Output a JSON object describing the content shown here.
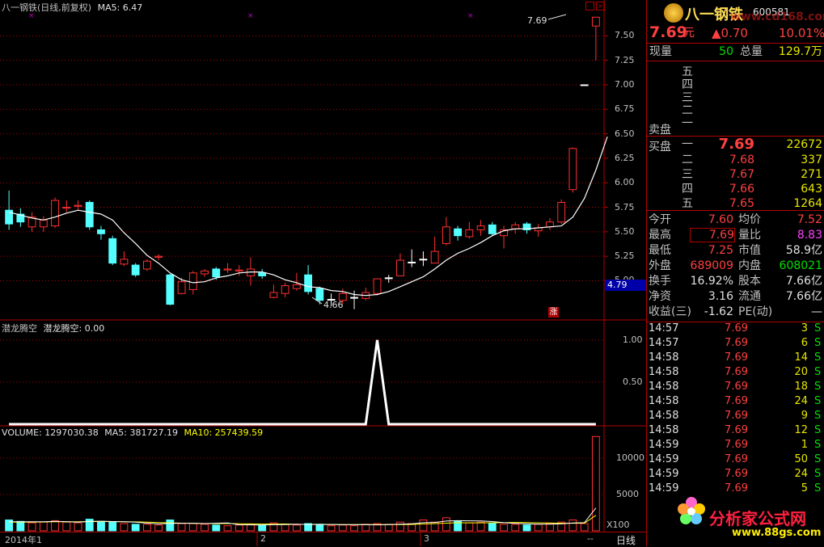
{
  "header": {
    "title": "八一钢铁(日线,前复权)",
    "ma_label": "MA5: 6.47",
    "indicator_label": "潜龙腾空",
    "indicator_value": "潜龙腾空: 0.00",
    "volume_label": "VOLUME: 1297030.38",
    "volume_ma5": "MA5: 381727.19",
    "volume_ma10": "MA10: 257439.59"
  },
  "price_axis": {
    "ticks": [
      "7.50",
      "7.25",
      "7.00",
      "6.75",
      "6.50",
      "6.25",
      "6.00",
      "5.75",
      "5.50",
      "5.25",
      "5.00"
    ],
    "cursor_value": "4.79"
  },
  "indicator_axis": {
    "ticks": [
      "1.00",
      "0.50"
    ]
  },
  "volume_axis": {
    "ticks": [
      "10000",
      "5000"
    ],
    "unit": "X100"
  },
  "annotations": {
    "high_marker": "7.69",
    "low_marker": "4.66",
    "zhang_badge": "涨"
  },
  "time_axis": {
    "labels": [
      "2014年1",
      "2",
      "3"
    ],
    "period": "日线",
    "nav": "--"
  },
  "colors": {
    "up": "#ff3030",
    "down": "#54ffff",
    "ma": "#ffffff",
    "grid": "#b00000",
    "ma5": "#ffffff",
    "ma10": "#ffff00"
  },
  "chart_data": {
    "type": "candlestick",
    "candles": [
      {
        "o": 5.72,
        "c": 5.58,
        "h": 5.92,
        "l": 5.52
      },
      {
        "o": 5.68,
        "c": 5.6,
        "h": 5.74,
        "l": 5.55
      },
      {
        "o": 5.55,
        "c": 5.65,
        "h": 5.7,
        "l": 5.5
      },
      {
        "o": 5.55,
        "c": 5.62,
        "h": 5.66,
        "l": 5.5
      },
      {
        "o": 5.56,
        "c": 5.82,
        "h": 5.85,
        "l": 5.54
      },
      {
        "o": 5.74,
        "c": 5.75,
        "h": 5.82,
        "l": 5.7
      },
      {
        "o": 5.76,
        "c": 5.77,
        "h": 5.82,
        "l": 5.72
      },
      {
        "o": 5.8,
        "c": 5.55,
        "h": 5.82,
        "l": 5.52
      },
      {
        "o": 5.52,
        "c": 5.48,
        "h": 5.56,
        "l": 5.42
      },
      {
        "o": 5.43,
        "c": 5.18,
        "h": 5.46,
        "l": 5.16
      },
      {
        "o": 5.17,
        "c": 5.22,
        "h": 5.3,
        "l": 5.15
      },
      {
        "o": 5.16,
        "c": 5.06,
        "h": 5.18,
        "l": 5.04
      },
      {
        "o": 5.12,
        "c": 5.2,
        "h": 5.22,
        "l": 5.1
      },
      {
        "o": 5.24,
        "c": 5.25,
        "h": 5.27,
        "l": 5.21
      },
      {
        "o": 5.06,
        "c": 4.76,
        "h": 5.07,
        "l": 4.75
      },
      {
        "o": 4.87,
        "c": 4.99,
        "h": 5.03,
        "l": 4.86
      },
      {
        "o": 4.91,
        "c": 5.08,
        "h": 5.1,
        "l": 4.86
      },
      {
        "o": 5.07,
        "c": 5.1,
        "h": 5.12,
        "l": 5.04
      },
      {
        "o": 5.12,
        "c": 5.04,
        "h": 5.14,
        "l": 5.01
      },
      {
        "o": 5.11,
        "c": 5.12,
        "h": 5.18,
        "l": 5.08
      },
      {
        "o": 5.1,
        "c": 5.11,
        "h": 5.16,
        "l": 5.05
      },
      {
        "o": 5.05,
        "c": 5.12,
        "h": 5.24,
        "l": 4.95
      },
      {
        "o": 5.08,
        "c": 5.05,
        "h": 5.12,
        "l": 5.02
      },
      {
        "o": 4.83,
        "c": 4.88,
        "h": 4.96,
        "l": 4.82
      },
      {
        "o": 4.87,
        "c": 4.95,
        "h": 4.98,
        "l": 4.83
      },
      {
        "o": 4.92,
        "c": 4.96,
        "h": 5.08,
        "l": 4.9
      },
      {
        "o": 5.06,
        "c": 4.89,
        "h": 5.16,
        "l": 4.86
      },
      {
        "o": 4.92,
        "c": 4.8,
        "h": 4.94,
        "l": 4.76
      },
      {
        "o": 4.81,
        "c": 4.81,
        "h": 4.87,
        "l": 4.74
      },
      {
        "o": 4.8,
        "c": 4.87,
        "h": 4.92,
        "l": 4.76
      },
      {
        "o": 4.83,
        "c": 4.83,
        "h": 4.9,
        "l": 4.71
      },
      {
        "o": 4.82,
        "c": 4.88,
        "h": 4.93,
        "l": 4.8
      },
      {
        "o": 4.87,
        "c": 5.02,
        "h": 5.02,
        "l": 4.85
      },
      {
        "o": 5.03,
        "c": 5.03,
        "h": 5.06,
        "l": 4.98
      },
      {
        "o": 5.05,
        "c": 5.21,
        "h": 5.28,
        "l": 5.05
      },
      {
        "o": 5.19,
        "c": 5.19,
        "h": 5.32,
        "l": 5.14
      },
      {
        "o": 5.22,
        "c": 5.22,
        "h": 5.3,
        "l": 5.15
      },
      {
        "o": 5.18,
        "c": 5.3,
        "h": 5.45,
        "l": 5.18
      },
      {
        "o": 5.38,
        "c": 5.55,
        "h": 5.65,
        "l": 5.36
      },
      {
        "o": 5.53,
        "c": 5.46,
        "h": 5.56,
        "l": 5.41
      },
      {
        "o": 5.45,
        "c": 5.52,
        "h": 5.6,
        "l": 5.43
      },
      {
        "o": 5.52,
        "c": 5.56,
        "h": 5.62,
        "l": 5.46
      },
      {
        "o": 5.57,
        "c": 5.48,
        "h": 5.6,
        "l": 5.46
      },
      {
        "o": 5.46,
        "c": 5.52,
        "h": 5.56,
        "l": 5.33
      },
      {
        "o": 5.53,
        "c": 5.57,
        "h": 5.6,
        "l": 5.48
      },
      {
        "o": 5.58,
        "c": 5.52,
        "h": 5.6,
        "l": 5.48
      },
      {
        "o": 5.51,
        "c": 5.54,
        "h": 5.58,
        "l": 5.45
      },
      {
        "o": 5.55,
        "c": 5.6,
        "h": 5.64,
        "l": 5.52
      },
      {
        "o": 5.6,
        "c": 5.8,
        "h": 5.83,
        "l": 5.58
      },
      {
        "o": 5.93,
        "c": 6.35,
        "h": 6.36,
        "l": 5.9
      },
      {
        "o": 7.0,
        "c": 7.0,
        "h": 7.0,
        "l": 7.0
      },
      {
        "o": 7.6,
        "c": 7.69,
        "h": 7.69,
        "l": 7.25
      }
    ],
    "ma5": [
      5.7,
      5.67,
      5.64,
      5.62,
      5.65,
      5.69,
      5.72,
      5.7,
      5.68,
      5.62,
      5.49,
      5.38,
      5.26,
      5.18,
      5.08,
      5.01,
      4.98,
      4.99,
      5.03,
      5.05,
      5.08,
      5.09,
      5.09,
      5.06,
      5.01,
      4.98,
      4.94,
      4.93,
      4.9,
      4.89,
      4.86,
      4.85,
      4.86,
      4.89,
      4.94,
      4.99,
      5.04,
      5.12,
      5.21,
      5.28,
      5.33,
      5.39,
      5.46,
      5.51,
      5.53,
      5.53,
      5.54,
      5.55,
      5.56,
      5.65,
      5.84,
      6.13,
      6.47
    ],
    "indicator": [
      0,
      0,
      0,
      0,
      0,
      0,
      0,
      0,
      0,
      0,
      0,
      0,
      0,
      0,
      0,
      0,
      0,
      0,
      0,
      0,
      0,
      0,
      0,
      0,
      0,
      0,
      0,
      0,
      0,
      0,
      0,
      0,
      1,
      0,
      0,
      0,
      0,
      0,
      0,
      0,
      0,
      0,
      0,
      0,
      0,
      0,
      0,
      0,
      0,
      0,
      0,
      0
    ],
    "volume": [
      1500,
      1300,
      1100,
      1200,
      1400,
      1200,
      1100,
      1600,
      1300,
      1200,
      1000,
      900,
      900,
      800,
      1500,
      1000,
      1000,
      900,
      800,
      700,
      800,
      900,
      800,
      1100,
      900,
      800,
      1000,
      900,
      700,
      800,
      700,
      900,
      1000,
      900,
      1200,
      1000,
      1500,
      1200,
      1800,
      1300,
      1100,
      1200,
      1000,
      900,
      900,
      800,
      900,
      1000,
      1200,
      1500,
      1000,
      12970
    ],
    "volume_ma5": [
      1250,
      1250,
      1250,
      1250,
      1300,
      1240,
      1200,
      1300,
      1320,
      1280,
      1240,
      1200,
      1060,
      960,
      1020,
      1040,
      1040,
      1000,
      1050,
      1080,
      840,
      820,
      800,
      840,
      860,
      900,
      880,
      900,
      880,
      840,
      840,
      860,
      820,
      860,
      920,
      960,
      1120,
      1160,
      1340,
      1400,
      1380,
      1360,
      1280,
      1120,
      1020,
      960,
      920,
      920,
      960,
      1080,
      1120,
      3140
    ],
    "volume_ma10": [
      1200,
      1200,
      1200,
      1220,
      1250,
      1250,
      1260,
      1270,
      1280,
      1270,
      1250,
      1230,
      1200,
      1140,
      1100,
      1060,
      1040,
      1000,
      1000,
      1010,
      980,
      960,
      930,
      930,
      940,
      900,
      880,
      880,
      860,
      860,
      860,
      870,
      860,
      860,
      870,
      880,
      950,
      1000,
      1060,
      1120,
      1100,
      1100,
      1110,
      1120,
      1150,
      1130,
      1100,
      1080,
      1040,
      1040,
      1050,
      2130
    ],
    "price_ylim": [
      4.6,
      7.75
    ],
    "volume_ylim": [
      0,
      14000
    ],
    "indicator_ylim": [
      0,
      1.2
    ]
  },
  "panel": {
    "logo_name": "八一钢铁",
    "logo_code": "600581",
    "watermark_top": "www.cd168.com",
    "price": "7.69",
    "unit": "元",
    "change": "▲0.70",
    "pct": "10.01%",
    "xianliang_label": "现量",
    "xianliang": "50",
    "zongliang_label": "总量",
    "zongliang": "129.7万",
    "sell_levels": [
      "五",
      "四",
      "三",
      "二",
      "一"
    ],
    "sell_label": "卖盘",
    "buy_label": "买盘",
    "buys": [
      {
        "lvl": "一",
        "price": "7.69",
        "vol": "22672"
      },
      {
        "lvl": "二",
        "price": "7.68",
        "vol": "337"
      },
      {
        "lvl": "三",
        "price": "7.67",
        "vol": "271"
      },
      {
        "lvl": "四",
        "price": "7.66",
        "vol": "643"
      },
      {
        "lvl": "五",
        "price": "7.65",
        "vol": "1264"
      }
    ],
    "stats": [
      {
        "l1": "今开",
        "v1": "7.60",
        "c1": "red",
        "l2": "均价",
        "v2": "7.52",
        "c2": "red"
      },
      {
        "l1": "最高",
        "v1": "7.69",
        "c1": "red",
        "l2": "量比",
        "v2": "8.83",
        "c2": "mag"
      },
      {
        "l1": "最低",
        "v1": "7.25",
        "c1": "red",
        "l2": "市值",
        "v2": "58.9亿",
        "c2": "wht"
      },
      {
        "l1": "外盘",
        "v1": "689009",
        "c1": "red",
        "l2": "内盘",
        "v2": "608021",
        "c2": "grn"
      },
      {
        "l1": "换手",
        "v1": "16.92%",
        "c1": "wht",
        "l2": "股本",
        "v2": "7.66亿",
        "c2": "wht"
      },
      {
        "l1": "净资",
        "v1": "3.16",
        "c1": "wht",
        "l2": "流通",
        "v2": "7.66亿",
        "c2": "wht"
      },
      {
        "l1": "收益(三)",
        "v1": "-1.62",
        "c1": "wht",
        "l2": "PE(动)",
        "v2": "—",
        "c2": "wht"
      }
    ],
    "ticks": [
      {
        "t": "14:57",
        "p": "7.69",
        "v": "3",
        "s": "S"
      },
      {
        "t": "14:57",
        "p": "7.69",
        "v": "6",
        "s": "S"
      },
      {
        "t": "14:58",
        "p": "7.69",
        "v": "14",
        "s": "S"
      },
      {
        "t": "14:58",
        "p": "7.69",
        "v": "20",
        "s": "S"
      },
      {
        "t": "14:58",
        "p": "7.69",
        "v": "18",
        "s": "S"
      },
      {
        "t": "14:58",
        "p": "7.69",
        "v": "24",
        "s": "S"
      },
      {
        "t": "14:58",
        "p": "7.69",
        "v": "9",
        "s": "S"
      },
      {
        "t": "14:58",
        "p": "7.69",
        "v": "12",
        "s": "S"
      },
      {
        "t": "14:59",
        "p": "7.69",
        "v": "1",
        "s": "S"
      },
      {
        "t": "14:59",
        "p": "7.69",
        "v": "50",
        "s": "S"
      },
      {
        "t": "14:59",
        "p": "7.69",
        "v": "24",
        "s": "S"
      },
      {
        "t": "14:59",
        "p": "7.69",
        "v": "5",
        "s": "S"
      }
    ],
    "watermark_brand": "分析家公式网",
    "watermark_url": "www.88gs.com"
  }
}
